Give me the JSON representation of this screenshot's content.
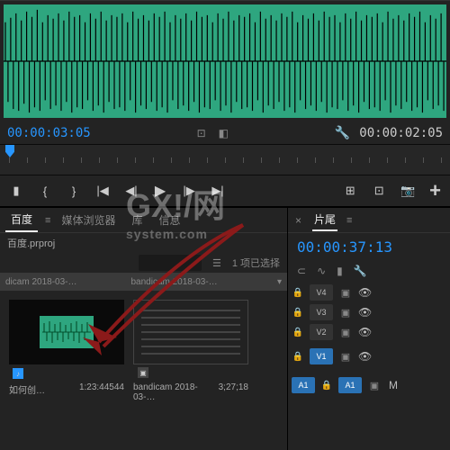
{
  "waveform": {
    "color": "#2ea67f"
  },
  "source_timecode": "00:00:03:05",
  "program_timecode": "00:00:02:05",
  "transport": {
    "mark_in": "{",
    "mark_out": "}",
    "go_in": "|◀",
    "step_back": "◀|",
    "play": "▶",
    "step_fwd": "|▶",
    "go_out": "▶|",
    "insert": "⊞",
    "overwrite": "⊡",
    "export": "📷",
    "plus": "+"
  },
  "project": {
    "tabs": {
      "active": "百度",
      "browser": "媒体浏览器",
      "lib": "库",
      "info": "信息"
    },
    "file": "百度.prproj",
    "search_placeholder": "",
    "selection_text": "1 项已选择",
    "header_col1": "dicam 2018-03-…",
    "header_col2": "bandicam 2018-03-…",
    "item1": {
      "name": "如何创…",
      "duration": "1:23:44544"
    },
    "item2": {
      "name": "bandicam 2018-03-…",
      "duration": "3;27;18"
    }
  },
  "sequence": {
    "tab": "片尾",
    "timecode": "00:00:37:13",
    "tracks": {
      "v4": "V4",
      "v3": "V3",
      "v2": "V2",
      "v1": "V1",
      "a1": "A1",
      "a1b": "A1"
    }
  },
  "watermark": {
    "big": "GX!/网",
    "small": "system.com"
  }
}
